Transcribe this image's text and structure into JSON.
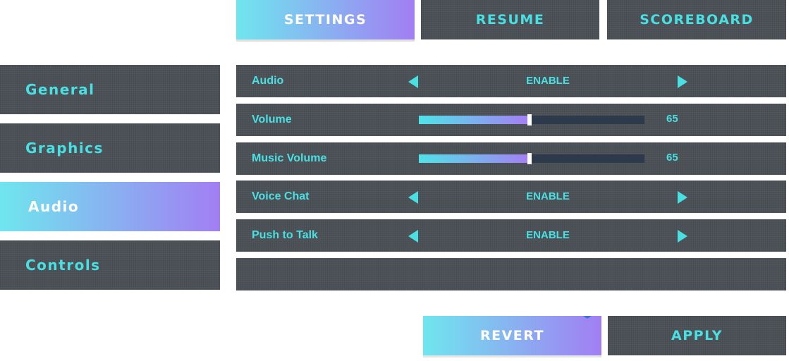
{
  "top_tabs": [
    {
      "label": "SETTINGS",
      "active": true
    },
    {
      "label": "RESUME",
      "active": false
    },
    {
      "label": "SCOREBOARD",
      "active": false
    }
  ],
  "sidebar": {
    "items": [
      {
        "label": "General",
        "active": false
      },
      {
        "label": "Graphics",
        "active": false
      },
      {
        "label": "Audio",
        "active": true
      },
      {
        "label": "Controls",
        "active": false
      }
    ]
  },
  "settings": {
    "audio": {
      "label": "Audio",
      "value": "ENABLE"
    },
    "volume": {
      "label": "Volume",
      "value": "65",
      "level_percent": 49
    },
    "music_volume": {
      "label": "Music Volume",
      "value": "65",
      "level_percent": 49
    },
    "voice_chat": {
      "label": "Voice Chat",
      "value": "ENABLE"
    },
    "push_to_talk": {
      "label": "Push to Talk",
      "value": "ENABLE"
    }
  },
  "buttons": {
    "revert": "REVERT",
    "apply": "APPLY"
  },
  "colors": {
    "accent": "#49e0e4",
    "gradient_start": "#6fe6ee",
    "gradient_end": "#a27ef3",
    "panel": "#4b5156"
  }
}
